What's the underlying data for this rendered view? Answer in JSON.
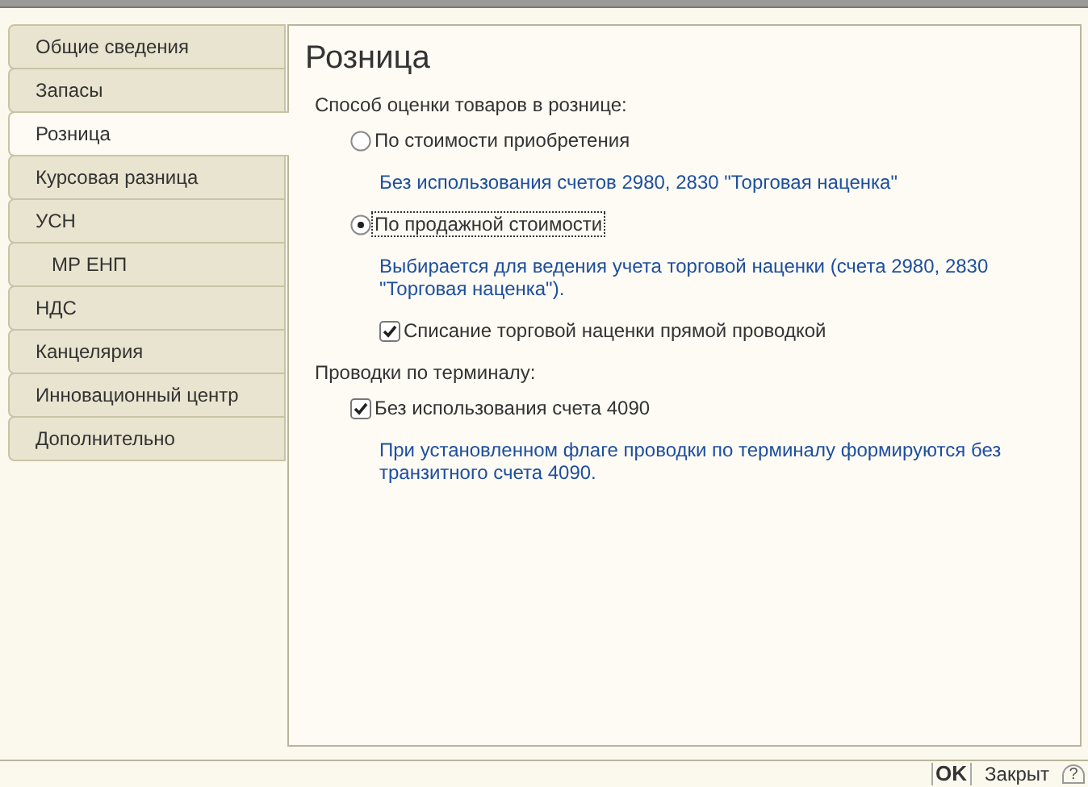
{
  "sidebar": {
    "items": [
      {
        "label": "Общие сведения",
        "selected": false,
        "indented": false
      },
      {
        "label": "Запасы",
        "selected": false,
        "indented": false
      },
      {
        "label": "Розница",
        "selected": true,
        "indented": false
      },
      {
        "label": "Курсовая разница",
        "selected": false,
        "indented": false
      },
      {
        "label": "УСН",
        "selected": false,
        "indented": false
      },
      {
        "label": "МР ЕНП",
        "selected": false,
        "indented": true
      },
      {
        "label": "НДС",
        "selected": false,
        "indented": false
      },
      {
        "label": "Канцелярия",
        "selected": false,
        "indented": false
      },
      {
        "label": "Инновационный центр",
        "selected": false,
        "indented": false
      },
      {
        "label": "Дополнительно",
        "selected": false,
        "indented": false
      }
    ]
  },
  "panel": {
    "title": "Розница",
    "rows": [
      {
        "kind": "heading",
        "text": "Способ оценки товаров в рознице:"
      },
      {
        "kind": "radio",
        "label": "По стоимости приобретения",
        "selected": false,
        "focused": false
      },
      {
        "kind": "hint",
        "text": "Без использования счетов 2980, 2830 \"Торговая наценка\""
      },
      {
        "kind": "radio",
        "label": "По продажной стоимости",
        "selected": true,
        "focused": true
      },
      {
        "kind": "hint",
        "text": "Выбирается для ведения учета торговой наценки (счета 2980, 2830 \"Торговая наценка\")."
      },
      {
        "kind": "subcheck",
        "label": "Списание торговой наценки прямой проводкой",
        "checked": true
      },
      {
        "kind": "heading",
        "text": "Проводки по терминалу:"
      },
      {
        "kind": "check",
        "label": "Без использования счета 4090",
        "checked": true
      },
      {
        "kind": "hint",
        "text": "При установленном флаге проводки по терминалу формируются без транзитного счета 4090."
      }
    ]
  },
  "footer": {
    "ok": "OK",
    "close": "Закрыт",
    "help": "?"
  }
}
